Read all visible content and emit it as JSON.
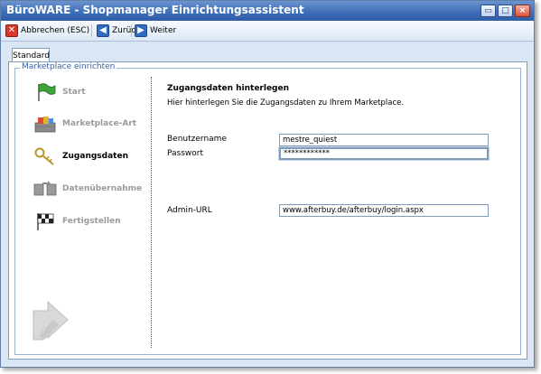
{
  "window": {
    "title": "BüroWARE - Shopmanager Einrichtungsassistent",
    "controls": [
      "restore-icon",
      "maximize-icon",
      "close-icon"
    ]
  },
  "toolbar": {
    "cancel_label": "Abbrechen (ESC)",
    "cancel_icon": "cancel-x-icon",
    "back_label": "Zurück",
    "back_icon": "arrow-left-icon",
    "next_label": "Weiter",
    "next_icon": "arrow-right-icon"
  },
  "tabs": [
    {
      "label": "Standard"
    }
  ],
  "group": {
    "legend": "Marketplace einrichten"
  },
  "steps": [
    {
      "label": "Start",
      "icon": "green-flag-icon",
      "active": false
    },
    {
      "label": "Marketplace-Art",
      "icon": "shopping-basket-icon",
      "active": false
    },
    {
      "label": "Zugangsdaten",
      "icon": "keys-icon",
      "active": true
    },
    {
      "label": "Datenübernahme",
      "icon": "data-transfer-icon",
      "active": false
    },
    {
      "label": "Fertigstellen",
      "icon": "checkered-flag-icon",
      "active": false
    }
  ],
  "content": {
    "heading": "Zugangsdaten hinterlegen",
    "description": "Hier hinterlegen Sie die Zugangsdaten zu Ihrem Marketplace.",
    "fields": [
      {
        "label": "Benutzername",
        "value": "mestre_quiest"
      },
      {
        "label": "Passwort",
        "value": "************"
      },
      {
        "label": "Admin-URL",
        "value": "www.afterbuy.de/afterbuy/login.aspx"
      }
    ]
  },
  "colors": {
    "title_bar": "#3f6fb8",
    "window_bg": "#dbe6f4",
    "legend_text": "#3a5fa3",
    "input_border": "#7f9db9"
  }
}
